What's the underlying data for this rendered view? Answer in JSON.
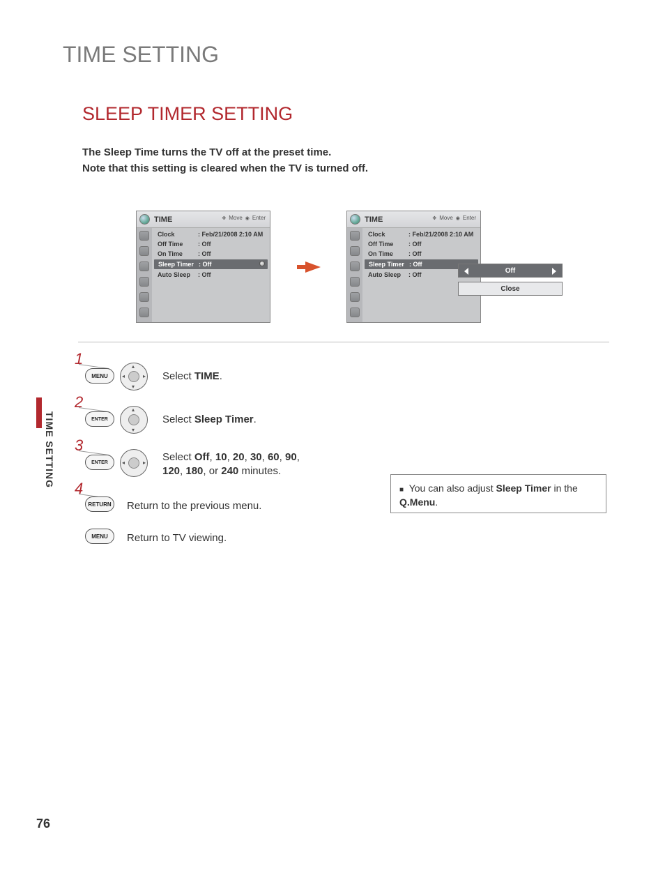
{
  "page": {
    "title": "TIME SETTING",
    "section_title": "SLEEP TIMER SETTING",
    "intro_line1": "The Sleep Time turns the TV off at the preset time.",
    "intro_line2": "Note that this setting is cleared when the TV is turned off.",
    "side_label": "TIME SETTING",
    "page_number": "76"
  },
  "osd": {
    "header_title": "TIME",
    "move_hint": "Move",
    "enter_hint": "Enter",
    "rows": {
      "clock_label": "Clock",
      "clock_value": ": Feb/21/2008  2:10 AM",
      "offtime_label": "Off Time",
      "offtime_value": ": Off",
      "ontime_label": "On Time",
      "ontime_value": ": Off",
      "sleep_label": "Sleep Timer",
      "sleep_value": ": Off",
      "autosleep_label": "Auto Sleep",
      "autosleep_value": ": Off"
    }
  },
  "popup": {
    "option": "Off",
    "close": "Close"
  },
  "steps": {
    "s1_num": "1",
    "s1_btn": "MENU",
    "s1_text_a": "Select ",
    "s1_text_b": "TIME",
    "s1_text_c": ".",
    "s2_num": "2",
    "s2_btn": "ENTER",
    "s2_text_a": "Select ",
    "s2_text_b": "Sleep Timer",
    "s2_text_c": ".",
    "s3_num": "3",
    "s3_btn": "ENTER",
    "s3_text_a": "Select ",
    "s3_text_b": "Off",
    "s3_sep": ", ",
    "s3_v10": "10",
    "s3_v20": "20",
    "s3_v30": "30",
    "s3_v60": "60",
    "s3_v90": "90",
    "s3_v120": "120",
    "s3_v180": "180",
    "s3_or": ", or ",
    "s3_v240": "240",
    "s3_tail": " minutes.",
    "s4_num": "4",
    "s4_btn": "RETURN",
    "s4_text": "Return to the previous menu.",
    "s5_btn": "MENU",
    "s5_text": "Return to TV viewing."
  },
  "tip": {
    "lead": "You can also adjust ",
    "bold1": "Sleep Timer",
    "mid": " in the ",
    "bold2": "Q.Menu",
    "tail": "."
  }
}
